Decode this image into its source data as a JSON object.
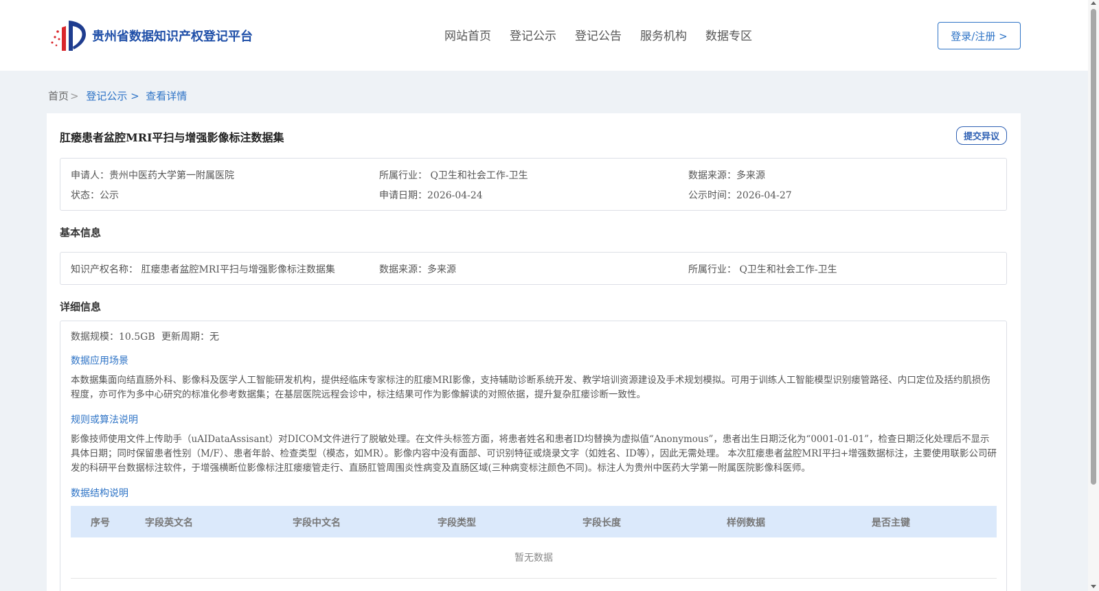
{
  "header": {
    "logo_text": "贵州省数据知识产权登记平台",
    "nav": [
      "网站首页",
      "登记公示",
      "登记公告",
      "服务机构",
      "数据专区"
    ],
    "login_label": "登录/注册 >"
  },
  "breadcrumb": {
    "home": "首页",
    "sep": ">",
    "items": [
      "登记公示 >",
      "查看详情"
    ]
  },
  "record": {
    "title": "肛瘘患者盆腔MRI平扫与增强影像标注数据集",
    "objection_label": "提交异议",
    "summary": {
      "applicant": "申请人：贵州中医药大学第一附属医院",
      "industry": "所属行业： Q卫生和社会工作-卫生",
      "source": "数据来源：多来源",
      "status": "状态：公示",
      "apply_date": "申请日期：2026-04-24",
      "publish_date": "公示时间：2026-04-27"
    },
    "basic_label": "基本信息",
    "basic": {
      "ip_name": "知识产权名称： 肛瘘患者盆腔MRI平扫与增强影像标注数据集",
      "source": "数据来源：多来源",
      "industry": "所属行业： Q卫生和社会工作-卫生"
    },
    "detail_label": "详细信息",
    "detail": {
      "scale": "数据规模：10.5GB",
      "update_cycle": "更新周期：无",
      "scenario_title": "数据应用场景",
      "scenario_text": "本数据集面向结直肠外科、影像科及医学人工智能研发机构，提供经临床专家标注的肛瘘MRI影像，支持辅助诊断系统开发、教学培训资源建设及手术规划模拟。可用于训练人工智能模型识别瘘管路径、内口定位及括约肌损伤程度，亦可作为多中心研究的标准化参考数据集；在基层医院远程会诊中，标注结果可作为影像解读的对照依据，提升复杂肛瘘诊断一致性。",
      "rules_title": "规则或算法说明",
      "rules_text": "影像技师使用文件上传助手（uAIDataAssisant）对DICOM文件进行了脱敏处理。在文件头标签方面，将患者姓名和患者ID均替换为虚拟值“Anonymous”，患者出生日期泛化为“0001-01-01”，检查日期泛化处理后不显示具体日期；同时保留患者性别（M/F）、患者年龄、检查类型（模态，如MR）。影像内容中没有面部、可识别特征或烧录文字（如姓名、ID等），因此无需处理。 本次肛瘘患者盆腔MRI平扫+增强数据标注，主要使用联影公司研发的科研平台数据标注软件，于增强横断位影像标注肛瘘瘘管走行、直肠肛管周围炎性病变及直肠区域(三种病变标注颜色不同)。标注人为贵州中医药大学第一附属医院影像科医师。",
      "structure_title": "数据结构说明",
      "table_headers": [
        "序号",
        "字段英文名",
        "字段中文名",
        "字段类型",
        "字段长度",
        "样例数据",
        "是否主键"
      ],
      "empty_text": "暂无数据"
    }
  },
  "colors": {
    "accent": "#2d73c6",
    "table_header_bg": "#dbe9fb",
    "page_bg": "#eef2f6"
  }
}
